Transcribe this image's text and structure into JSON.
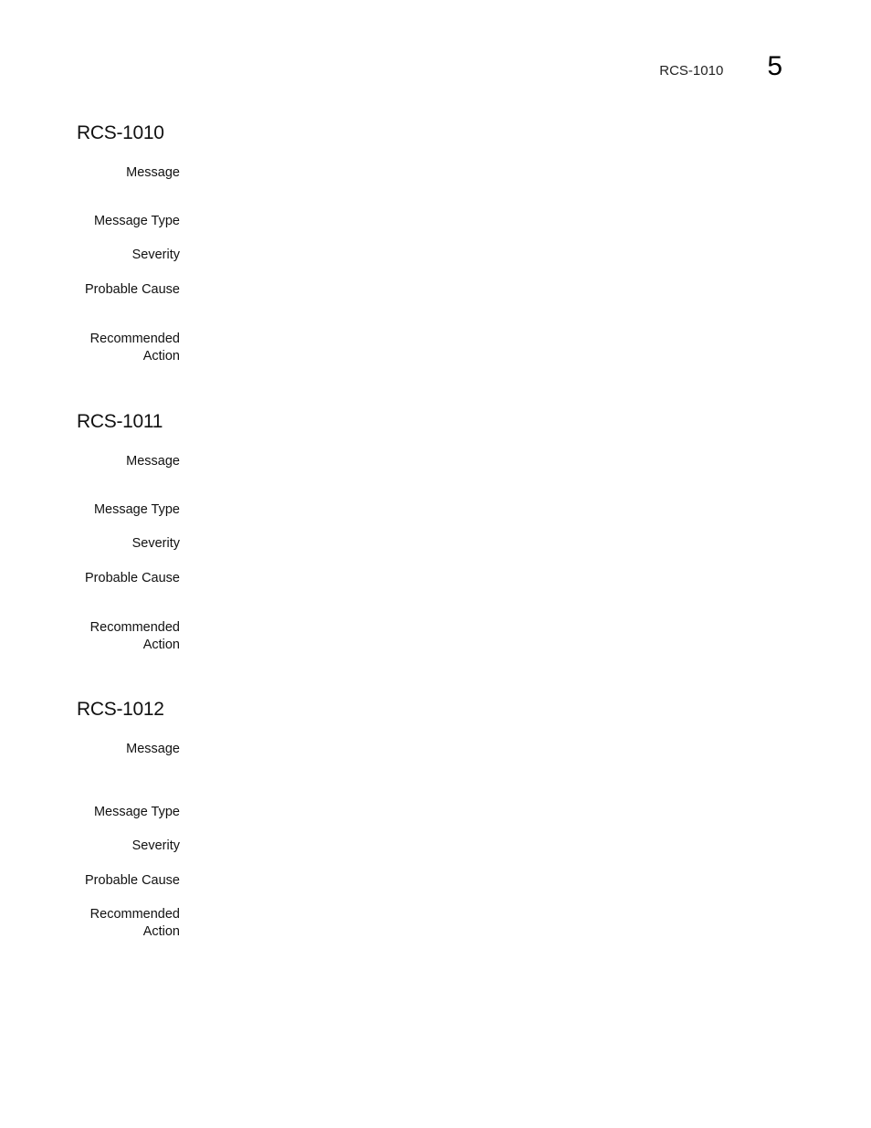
{
  "running_header": {
    "section_ref": "RCS-1010",
    "chapter_number": "5"
  },
  "entries": [
    {
      "title": "RCS-1010",
      "fields": [
        {
          "label": "Message",
          "value": ""
        },
        {
          "label": "Message Type",
          "value": ""
        },
        {
          "label": "Severity",
          "value": ""
        },
        {
          "label": "Probable Cause",
          "value": ""
        },
        {
          "label": "Recommended\nAction",
          "value": ""
        }
      ]
    },
    {
      "title": "RCS-1011",
      "fields": [
        {
          "label": "Message",
          "value": ""
        },
        {
          "label": "Message Type",
          "value": ""
        },
        {
          "label": "Severity",
          "value": ""
        },
        {
          "label": "Probable Cause",
          "value": ""
        },
        {
          "label": "Recommended\nAction",
          "value": ""
        }
      ]
    },
    {
      "title": "RCS-1012",
      "fields": [
        {
          "label": "Message",
          "value": ""
        },
        {
          "label": "Message Type",
          "value": ""
        },
        {
          "label": "Severity",
          "value": ""
        },
        {
          "label": "Probable Cause",
          "value": ""
        },
        {
          "label": "Recommended\nAction",
          "value": ""
        }
      ]
    }
  ]
}
